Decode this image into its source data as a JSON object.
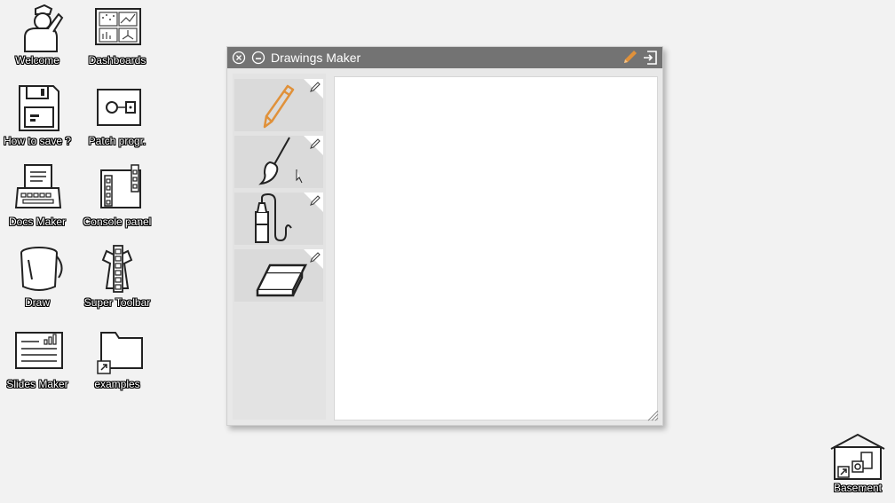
{
  "desktop": {
    "icons": [
      {
        "id": "welcome",
        "label": "Welcome",
        "icon": "person-hat-icon"
      },
      {
        "id": "dashboards",
        "label": "Dashboards",
        "icon": "dashboard-icon"
      },
      {
        "id": "howtosave",
        "label": "How to save ?",
        "icon": "floppy-disk-icon"
      },
      {
        "id": "patchprogr",
        "label": "Patch progr.",
        "icon": "patch-icon"
      },
      {
        "id": "docsmaker",
        "label": "Docs Maker",
        "icon": "typewriter-icon"
      },
      {
        "id": "consolepanel",
        "label": "Console panel",
        "icon": "console-panel-icon"
      },
      {
        "id": "draw",
        "label": "Draw",
        "icon": "paint-bucket-icon"
      },
      {
        "id": "supertoolbar",
        "label": "Super Toolbar",
        "icon": "toolbar-icon"
      },
      {
        "id": "slidesmaker",
        "label": "Slides Maker",
        "icon": "slides-icon"
      },
      {
        "id": "examples",
        "label": "examples",
        "icon": "folder-shortcut-icon"
      },
      {
        "id": "basement",
        "label": "Basement",
        "icon": "house-icon"
      }
    ]
  },
  "window": {
    "title": "Drawings Maker",
    "tools": [
      {
        "name": "pencil",
        "icon": "pencil-icon",
        "selected": true
      },
      {
        "name": "brush",
        "icon": "brush-icon",
        "selected": false
      },
      {
        "name": "marker",
        "icon": "marker-icon",
        "selected": false
      },
      {
        "name": "eraser",
        "icon": "eraser-icon",
        "selected": false
      }
    ]
  },
  "colors": {
    "desktop_bg": "#f2f2f2",
    "titlebar_bg": "#737373",
    "accent": "#e0913a",
    "panel_bg": "#e3e3e3",
    "tool_bg": "#dadada",
    "canvas_bg": "#ffffff"
  }
}
